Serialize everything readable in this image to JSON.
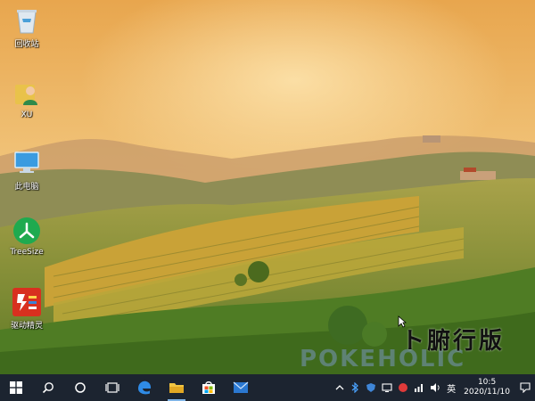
{
  "desktop": {
    "icons": [
      {
        "name": "recycle-bin",
        "label": "回收站"
      },
      {
        "name": "user-folder",
        "label": "XU"
      },
      {
        "name": "this-pc",
        "label": "此电脑"
      },
      {
        "name": "treesize",
        "label": "TreeSize"
      },
      {
        "name": "driver-genius",
        "label": "驱动精灵"
      }
    ],
    "watermark_text": "ト腑行版",
    "watermark_text2": "POKEHOLIC"
  },
  "taskbar": {
    "ime_label": "英",
    "clock": {
      "time": "10:5",
      "date": "2020/11/10"
    },
    "colors": {
      "bg": "#1c2430",
      "accent": "#0078d7"
    }
  }
}
